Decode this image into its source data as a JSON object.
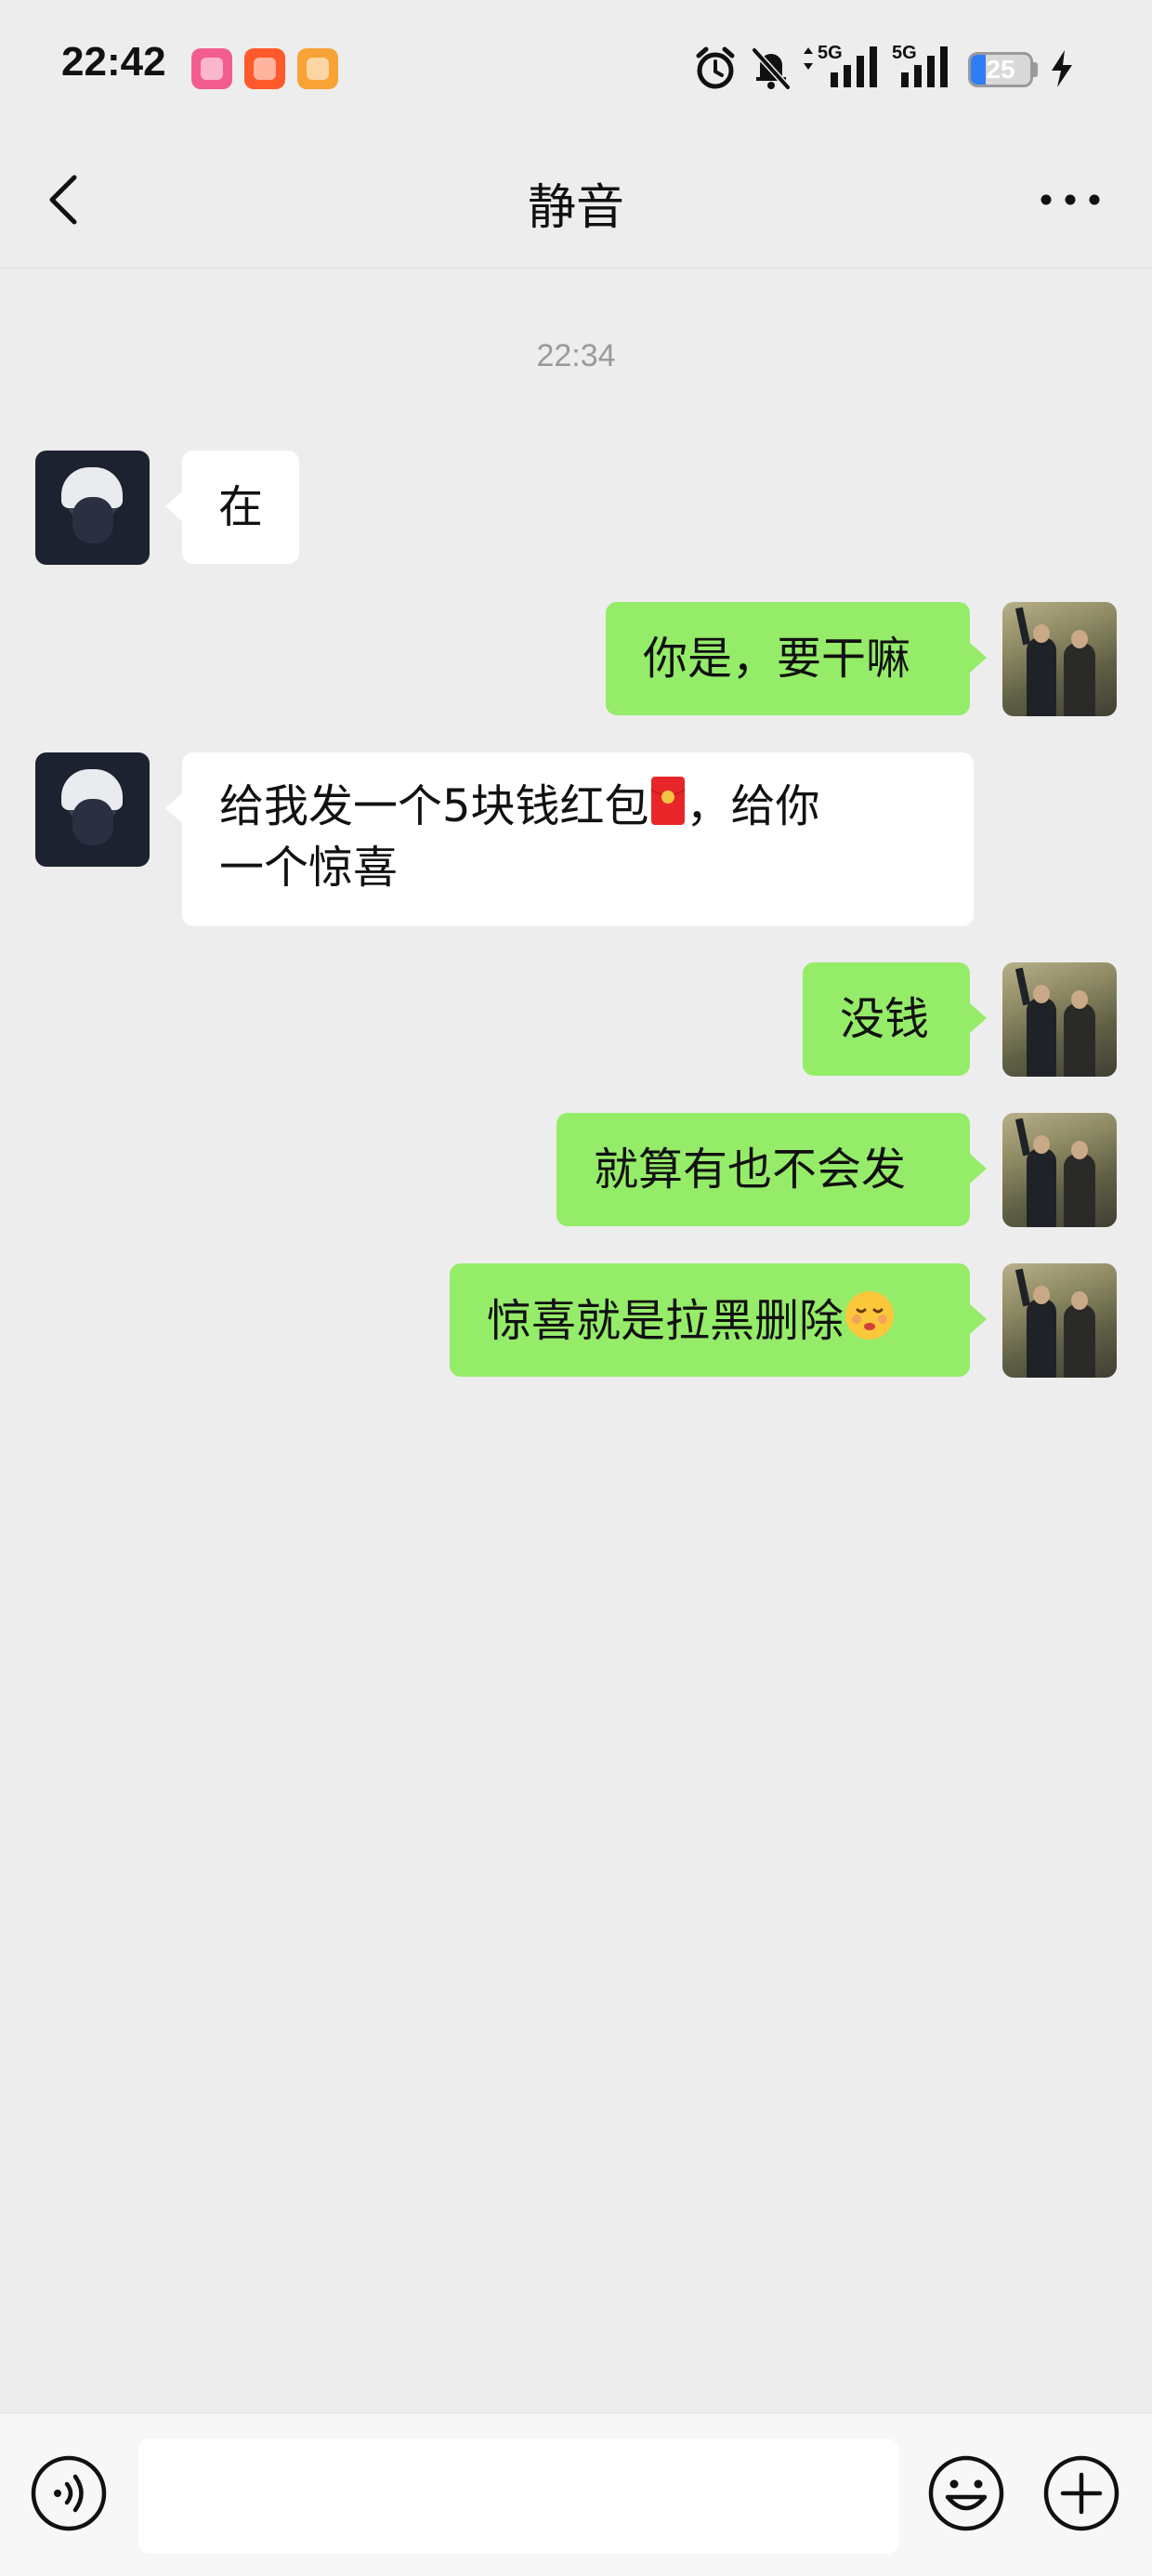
{
  "status_bar": {
    "time": "22:42",
    "network_labels": [
      "5G",
      "5G"
    ],
    "battery_level": 25,
    "battery_text": "25",
    "icons": [
      "bilibili-app-icon",
      "taobao-app-icon",
      "video-app-icon",
      "alarm-icon",
      "silent-bell-icon",
      "signal-icon",
      "signal-icon",
      "battery-icon",
      "charging-icon"
    ]
  },
  "nav": {
    "title": "静音",
    "back_icon": "chevron-left-icon",
    "more_icon": "more-dots-icon"
  },
  "chat": {
    "timestamp": "22:34",
    "messages": [
      {
        "side": "in",
        "text": "在"
      },
      {
        "side": "out",
        "text": "你是，要干嘛"
      },
      {
        "side": "in",
        "text_before_icon": "给我发一个5块钱红包",
        "inline_icon": "red-envelope-icon",
        "text_line1_after": "，给你",
        "text_line2": "一个惊喜"
      },
      {
        "side": "out",
        "text": "没钱"
      },
      {
        "side": "out",
        "text": "就算有也不会发"
      },
      {
        "side": "out",
        "text": "惊喜就是拉黑删除",
        "inline_icon": "shushing-face-emoji"
      }
    ]
  },
  "input_bar": {
    "voice_icon": "voice-icon",
    "input_value": "",
    "emoji_icon": "emoji-smile-icon",
    "plus_icon": "plus-circle-icon"
  },
  "colors": {
    "background": "#ededed",
    "incoming_bubble": "#ffffff",
    "outgoing_bubble": "#95ec69",
    "battery_fill": "#2f7df6"
  }
}
